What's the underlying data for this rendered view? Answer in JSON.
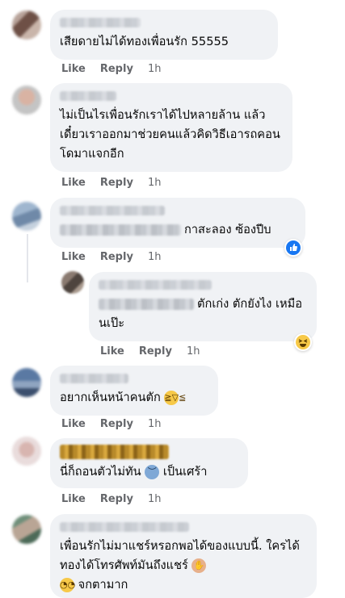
{
  "comments": [
    {
      "text": "เสียดายไม่ได้ทองเพื่อนรัก 55555",
      "like": "Like",
      "reply": "Reply",
      "time": "1h"
    },
    {
      "text": "ไม่เป็นไรเพื่อนรักเราได้ไปหลายล้าน แล้วเดี๋ยวเราออกมาช่วยคนแล้วคิดวิธีเอารถคอนโดมาแจกอีก",
      "like": "Like",
      "reply": "Reply",
      "time": "1h"
    },
    {
      "text": "กาสะลอง ซ้องปีบ",
      "like": "Like",
      "reply": "Reply",
      "time": "1h"
    },
    {
      "text": "ตักเก่ง ตักยังไง เหมือนเป๊ะ",
      "like": "Like",
      "reply": "Reply",
      "time": "1h"
    },
    {
      "text": "อยากเห็นหน้าคนตัก",
      "like": "Like",
      "reply": "Reply",
      "time": "1h"
    },
    {
      "text": "นี่ก็ถอนตัวไม่ทัน",
      "text2": "เป็นเศร้า",
      "like": "Like",
      "reply": "Reply",
      "time": "1h"
    },
    {
      "text": "เพื่อนรักไม่มาแชร์หรอกพอได้ของแบบนี้. ใครได้ทองได้โทรศัพท์มันถึงแชร์",
      "text2": "จกตามาก"
    }
  ],
  "icons": {
    "like_reaction": "thumbs-up-icon",
    "haha_reaction": "laughing-face-icon",
    "laugh_emoji": "grinning-squint-icon",
    "sad_emoji": "anxious-sweat-icon",
    "facepalm_emoji": "person-facepalming-icon",
    "eyeroll_emoji": "face-rolling-eyes-icon"
  },
  "colors": {
    "like_blue": "#1877f2",
    "bubble": "#f0f2f5",
    "meta": "#65676b",
    "emoji_yellow": "#f7c948"
  }
}
